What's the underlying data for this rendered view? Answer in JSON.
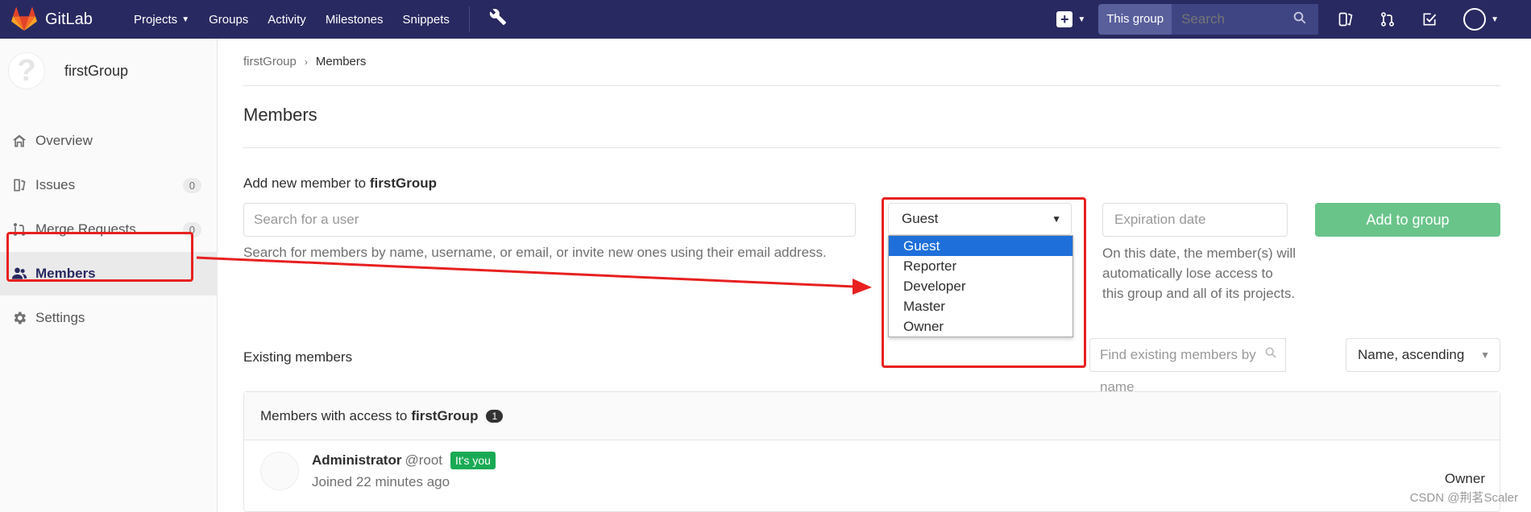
{
  "nav": {
    "brand": "GitLab",
    "links": [
      {
        "label": "Projects",
        "has_dropdown": true
      },
      {
        "label": "Groups",
        "has_dropdown": false
      },
      {
        "label": "Activity",
        "has_dropdown": false
      },
      {
        "label": "Milestones",
        "has_dropdown": false
      },
      {
        "label": "Snippets",
        "has_dropdown": false
      }
    ],
    "search_scope": "This group",
    "search_placeholder": "Search",
    "brand_color": "#292961"
  },
  "sidebar": {
    "group_name": "firstGroup",
    "group_avatar_glyph": "?",
    "items": [
      {
        "label": "Overview",
        "icon": "home-icon"
      },
      {
        "label": "Issues",
        "icon": "issues-icon",
        "count": "0"
      },
      {
        "label": "Merge Requests",
        "icon": "merge-request-icon",
        "count": "0"
      },
      {
        "label": "Members",
        "icon": "users-icon",
        "active": true
      },
      {
        "label": "Settings",
        "icon": "gear-icon"
      }
    ]
  },
  "breadcrumb": {
    "group": "firstGroup",
    "current": "Members"
  },
  "page_title": "Members",
  "add_member": {
    "label_prefix": "Add new member to",
    "group": "firstGroup",
    "user_placeholder": "Search for a user",
    "help": "Search for members by name, username, or email, or invite new ones using their email address.",
    "role_value": "Guest",
    "role_options": [
      "Guest",
      "Reporter",
      "Developer",
      "Master",
      "Owner"
    ],
    "expiration_placeholder": "Expiration date",
    "expiration_help": "On this date, the member(s) will automatically lose access to this group and all of its projects.",
    "add_button": "Add to group"
  },
  "existing": {
    "label": "Existing members",
    "find_placeholder": "Find existing members by name",
    "sort_value": "Name, ascending",
    "panel_prefix": "Members with access to",
    "panel_group": "firstGroup",
    "panel_count": "1",
    "members": [
      {
        "name": "Administrator",
        "username": "@root",
        "badge": "It's you",
        "joined": "Joined 22 minutes ago",
        "role": "Owner"
      }
    ]
  },
  "watermark": "CSDN @荆茗Scaler"
}
